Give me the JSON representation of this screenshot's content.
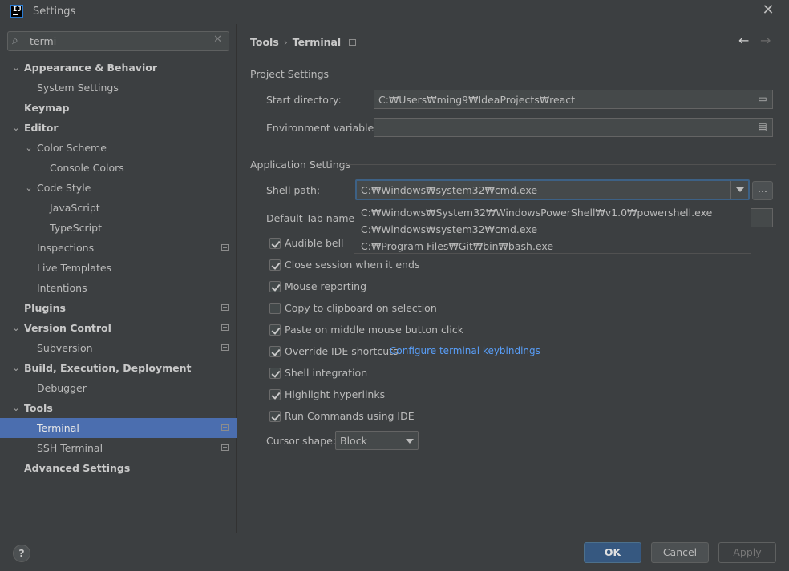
{
  "window": {
    "title": "Settings",
    "logo_text": "IJ"
  },
  "search": {
    "value": "termi"
  },
  "sidebar": {
    "items": [
      {
        "label": "Appearance & Behavior",
        "bold": true,
        "expanded": true
      },
      {
        "label": "System Settings"
      },
      {
        "label": "Keymap",
        "bold": true
      },
      {
        "label": "Editor",
        "bold": true,
        "expanded": true
      },
      {
        "label": "Color Scheme",
        "expanded": true
      },
      {
        "label": "Console Colors"
      },
      {
        "label": "Code Style",
        "expanded": true
      },
      {
        "label": "JavaScript"
      },
      {
        "label": "TypeScript"
      },
      {
        "label": "Inspections",
        "modified": true
      },
      {
        "label": "Live Templates"
      },
      {
        "label": "Intentions"
      },
      {
        "label": "Plugins",
        "bold": true,
        "modified": true
      },
      {
        "label": "Version Control",
        "bold": true,
        "expanded": true,
        "modified": true
      },
      {
        "label": "Subversion",
        "modified": true
      },
      {
        "label": "Build, Execution, Deployment",
        "bold": true,
        "expanded": true
      },
      {
        "label": "Debugger"
      },
      {
        "label": "Tools",
        "bold": true,
        "expanded": true
      },
      {
        "label": "Terminal",
        "selected": true,
        "modified": true
      },
      {
        "label": "SSH Terminal",
        "modified": true
      },
      {
        "label": "Advanced Settings",
        "bold": true
      }
    ]
  },
  "breadcrumb": {
    "parent": "Tools",
    "separator": "›",
    "current": "Terminal"
  },
  "project_settings": {
    "title": "Project Settings",
    "start_directory_label": "Start directory:",
    "start_directory_value": "C:₩Users₩ming9₩IdeaProjects₩react",
    "env_vars_label": "Environment variables:",
    "env_vars_value": ""
  },
  "application_settings": {
    "title": "Application Settings",
    "shell_path_label": "Shell path:",
    "shell_path_value": "C:₩Windows₩system32₩cmd.exe",
    "browse_label": "...",
    "default_tab_label": "Default Tab name:",
    "shell_options": [
      "C:₩Windows₩System32₩WindowsPowerShell₩v1.0₩powershell.exe",
      "C:₩Windows₩system32₩cmd.exe",
      "C:₩Program Files₩Git₩bin₩bash.exe"
    ],
    "checkboxes": [
      {
        "label": "Audible bell",
        "checked": true
      },
      {
        "label": "Close session when it ends",
        "checked": true
      },
      {
        "label": "Mouse reporting",
        "checked": true
      },
      {
        "label": "Copy to clipboard on selection",
        "checked": false
      },
      {
        "label": "Paste on middle mouse button click",
        "checked": true
      },
      {
        "label": "Override IDE shortcuts",
        "checked": true
      },
      {
        "label": "Shell integration",
        "checked": true
      },
      {
        "label": "Highlight hyperlinks",
        "checked": true
      },
      {
        "label": "Run Commands using IDE",
        "checked": true
      }
    ],
    "keybindings_link": "Configure terminal keybindings",
    "cursor_shape_label": "Cursor shape:",
    "cursor_shape_value": "Block"
  },
  "footer": {
    "help_label": "?",
    "ok_label": "OK",
    "cancel_label": "Cancel",
    "apply_label": "Apply"
  },
  "colors": {
    "background": "#3c3f41",
    "selection": "#4b6eaf",
    "link": "#589df6",
    "primary_button": "#365880"
  }
}
